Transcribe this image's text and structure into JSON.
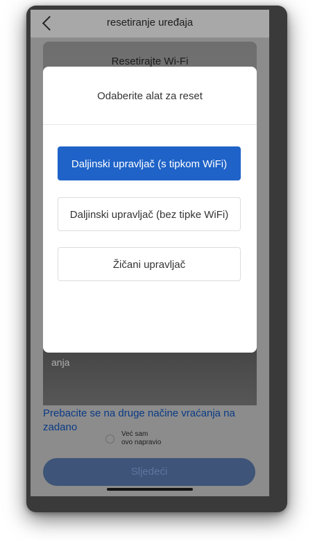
{
  "header": {
    "title": "resetiranje uređaja"
  },
  "hero": {
    "title": "Resetirajte Wi-Fi",
    "caption": "anja"
  },
  "footer": {
    "switch_link": "Prebacite se na druge načine vraćanja na zadano",
    "checkbox_label_line1": "Već sam",
    "checkbox_label_line2": "ovo napravio",
    "next_button": "Sljedeći"
  },
  "modal": {
    "title": "Odaberite alat za reset",
    "options": [
      {
        "label": "Daljinski upravljač (s tipkom WiFi)",
        "selected": true
      },
      {
        "label": "Daljinski upravljač (bez tipke WiFi)",
        "selected": false
      },
      {
        "label": "Žičani upravljač",
        "selected": false
      }
    ]
  },
  "colors": {
    "accent": "#1f63c8",
    "link": "#0a3a86"
  }
}
